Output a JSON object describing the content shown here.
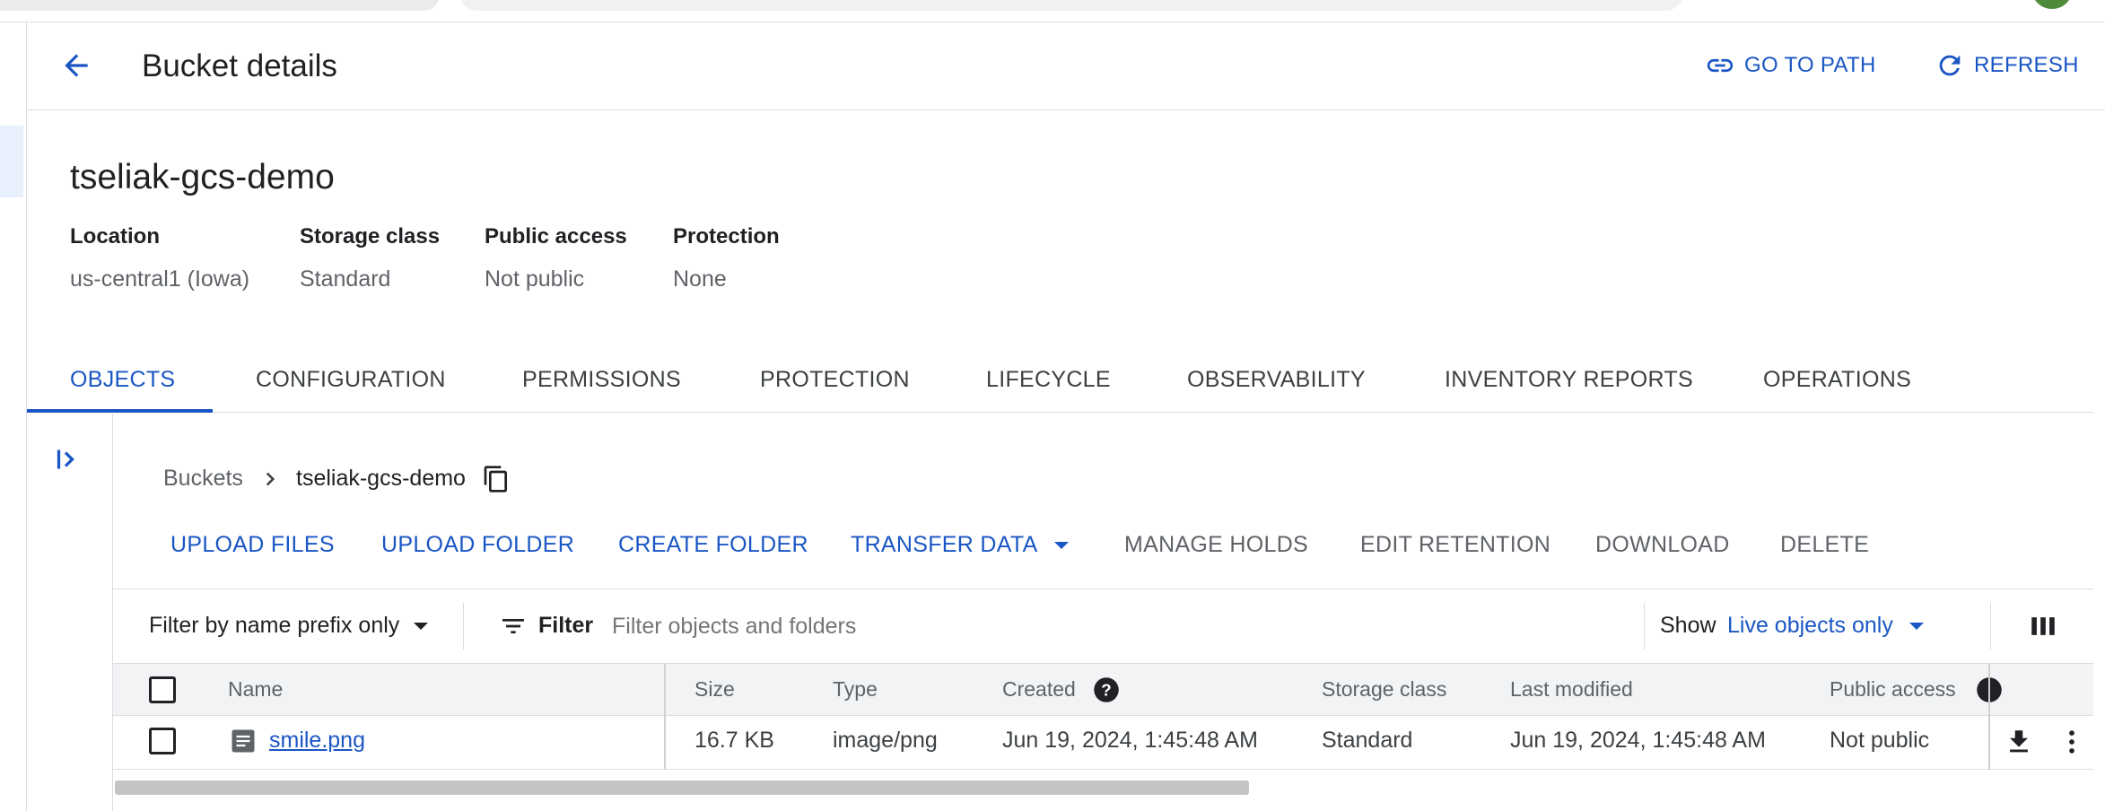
{
  "header": {
    "title": "Bucket details",
    "go_to_path": "GO TO PATH",
    "refresh": "REFRESH"
  },
  "bucket": {
    "name": "tseliak-gcs-demo",
    "meta": [
      {
        "label": "Location",
        "value": "us-central1 (Iowa)"
      },
      {
        "label": "Storage class",
        "value": "Standard"
      },
      {
        "label": "Public access",
        "value": "Not public"
      },
      {
        "label": "Protection",
        "value": "None"
      }
    ]
  },
  "tabs": [
    "OBJECTS",
    "CONFIGURATION",
    "PERMISSIONS",
    "PROTECTION",
    "LIFECYCLE",
    "OBSERVABILITY",
    "INVENTORY REPORTS",
    "OPERATIONS"
  ],
  "breadcrumb": {
    "root": "Buckets",
    "current": "tseliak-gcs-demo"
  },
  "actions": {
    "upload_files": "UPLOAD FILES",
    "upload_folder": "UPLOAD FOLDER",
    "create_folder": "CREATE FOLDER",
    "transfer_data": "TRANSFER DATA",
    "manage_holds": "MANAGE HOLDS",
    "edit_retention": "EDIT RETENTION",
    "download": "DOWNLOAD",
    "delete": "DELETE"
  },
  "filter": {
    "prefix_mode": "Filter by name prefix only",
    "label": "Filter",
    "placeholder": "Filter objects and folders",
    "show_label": "Show",
    "show_value": "Live objects only"
  },
  "table": {
    "headers": {
      "name": "Name",
      "size": "Size",
      "type": "Type",
      "created": "Created",
      "storage_class": "Storage class",
      "last_modified": "Last modified",
      "public_access": "Public access"
    },
    "rows": [
      {
        "name": "smile.png",
        "size": "16.7 KB",
        "type": "image/png",
        "created": "Jun 19, 2024, 1:45:48 AM",
        "storage_class": "Standard",
        "last_modified": "Jun 19, 2024, 1:45:48 AM",
        "public_access": "Not public"
      }
    ]
  },
  "colors": {
    "accent": "#1a56c4",
    "text_primary": "#202124",
    "text_secondary": "#5f6368",
    "border": "#dadce0",
    "header_bg": "#f1f3f4"
  }
}
